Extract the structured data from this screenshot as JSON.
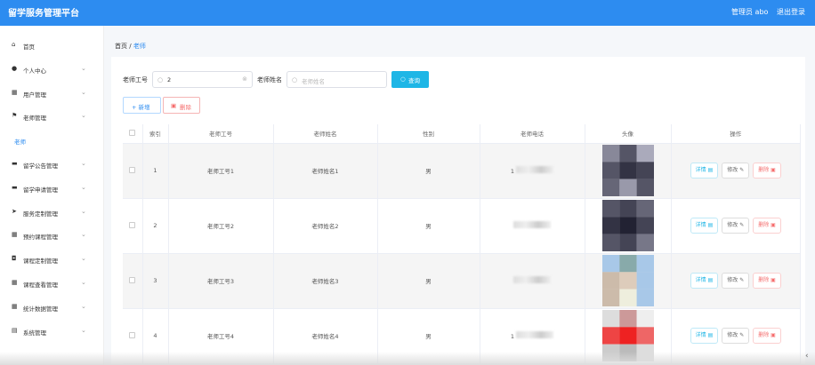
{
  "app": {
    "title": "留学服务管理平台",
    "user": "管理员 abo",
    "logout": "退出登录"
  },
  "sidebar": {
    "items": [
      {
        "label": "首页",
        "icon": "home-icon",
        "glyph": "⌂",
        "expand": false
      },
      {
        "label": "个人中心",
        "icon": "user-icon",
        "glyph": "●",
        "expand": true
      },
      {
        "label": "用户管理",
        "icon": "grid-icon",
        "glyph": "▦",
        "expand": true
      },
      {
        "label": "老师管理",
        "icon": "flag-icon",
        "glyph": "⚑",
        "expand": true
      },
      {
        "label": "老师",
        "icon": "",
        "glyph": "",
        "expand": false,
        "sub": true
      },
      {
        "label": "留学公告管理",
        "icon": "comment-icon",
        "glyph": "▬",
        "expand": true
      },
      {
        "label": "留学申请管理",
        "icon": "comment-icon",
        "glyph": "▬",
        "expand": true
      },
      {
        "label": "服务定制管理",
        "icon": "send-icon",
        "glyph": "➤",
        "expand": true
      },
      {
        "label": "预约课程管理",
        "icon": "grid-icon",
        "glyph": "▦",
        "expand": true
      },
      {
        "label": "课程定制管理",
        "icon": "gamepad-icon",
        "glyph": "◘",
        "expand": true
      },
      {
        "label": "课程查看管理",
        "icon": "grid-icon",
        "glyph": "▦",
        "expand": true
      },
      {
        "label": "统计数据管理",
        "icon": "grid-icon",
        "glyph": "▦",
        "expand": true
      },
      {
        "label": "系统管理",
        "icon": "table-icon",
        "glyph": "▤",
        "expand": true
      }
    ]
  },
  "breadcrumb": {
    "home": "首页",
    "sep": "/",
    "current": "老师"
  },
  "search": {
    "label1": "老师工号",
    "value1": "2",
    "label2": "老师姓名",
    "placeholder2": "老师姓名",
    "query": "查询"
  },
  "toolbar": {
    "add": "+ 新增",
    "del": "删除"
  },
  "table": {
    "headers": [
      "",
      "索引",
      "老师工号",
      "老师姓名",
      "性别",
      "老师电话",
      "头像",
      "操作"
    ],
    "rows": [
      {
        "idx": "1",
        "no": "老师工号1",
        "name": "老师姓名1",
        "sex": "男",
        "phone_prefix": "1"
      },
      {
        "idx": "2",
        "no": "老师工号2",
        "name": "老师姓名2",
        "sex": "男",
        "phone_prefix": ""
      },
      {
        "idx": "3",
        "no": "老师工号3",
        "name": "老师姓名3",
        "sex": "男",
        "phone_prefix": ""
      },
      {
        "idx": "4",
        "no": "老师工号4",
        "name": "老师姓名4",
        "sex": "男",
        "phone_prefix": "1"
      }
    ],
    "actions": {
      "detail": "详情",
      "edit": "修改",
      "remove": "删除"
    }
  },
  "avatars": [
    [
      "#889",
      "#556",
      "#aab",
      "#556",
      "#334",
      "#445",
      "#667",
      "#99a",
      "#556"
    ],
    [
      "#556",
      "#445",
      "#667",
      "#334",
      "#223",
      "#445",
      "#556",
      "#445",
      "#778"
    ],
    [
      "#a8c8e8",
      "#8aa",
      "#a8c8e8",
      "#cba",
      "#dcb",
      "#a8c8e8",
      "#cba",
      "#eed",
      "#a8c8e8"
    ],
    [
      "#ddd",
      "#c99",
      "#eee",
      "#e44",
      "#e22",
      "#e66",
      "#ccc",
      "#bbb",
      "#ddd"
    ]
  ]
}
